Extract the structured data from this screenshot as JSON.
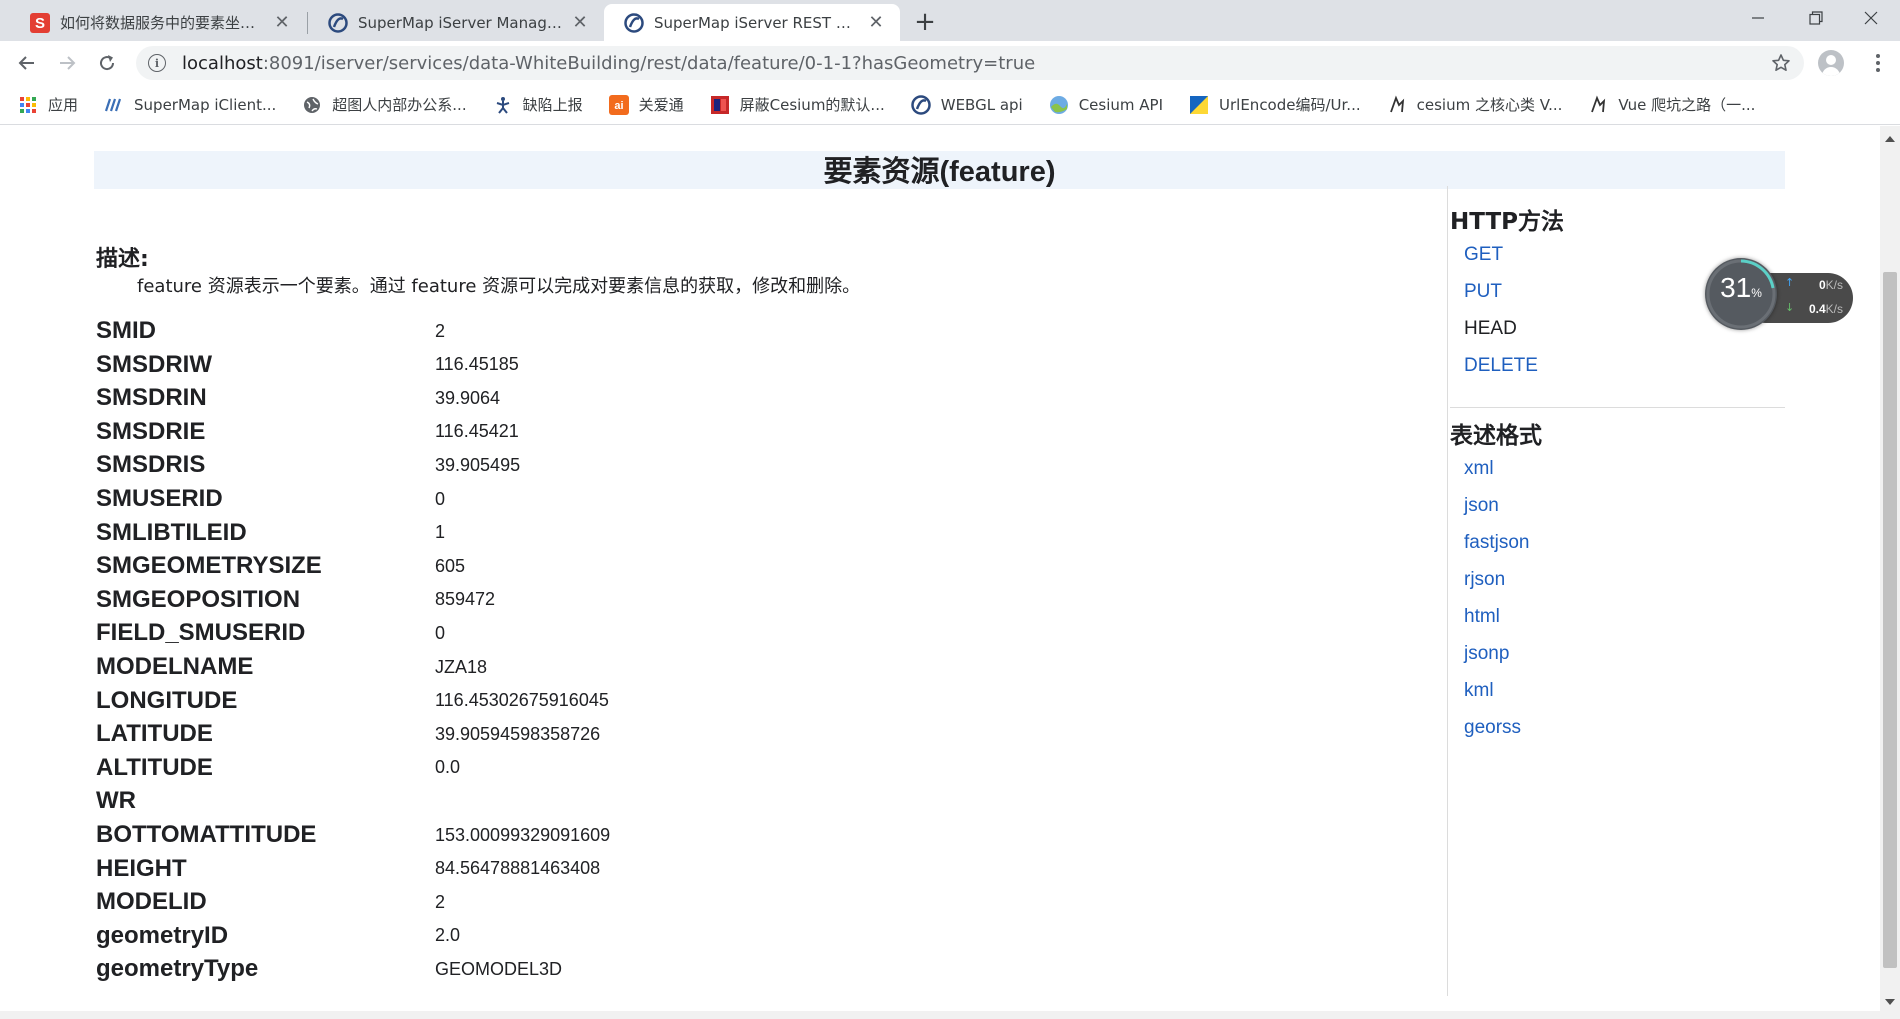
{
  "browser": {
    "tabs": [
      {
        "title": "如何将数据服务中的要素坐标转换",
        "favicon": "csdn-icon",
        "active": false
      },
      {
        "title": "SuperMap iServer Manager",
        "favicon": "supermap-icon",
        "active": false
      },
      {
        "title": "SuperMap iServer REST API",
        "favicon": "supermap-icon",
        "active": true
      }
    ],
    "url_host": "localhost",
    "url_rest": ":8091/iserver/services/data-WhiteBuilding/rest/data/feature/0-1-1?hasGeometry=true",
    "bookmarks": [
      {
        "label": "应用",
        "icon": "apps-grid-icon"
      },
      {
        "label": "SuperMap iClient...",
        "icon": "supermap-icon"
      },
      {
        "label": "超图人内部办公系...",
        "icon": "globe-icon"
      },
      {
        "label": "缺陷上报",
        "icon": "bug-icon"
      },
      {
        "label": "关爱通",
        "icon": "guanaitong-icon"
      },
      {
        "label": "屏蔽Cesium的默认...",
        "icon": "cesium-doc-icon"
      },
      {
        "label": "WEBGL api",
        "icon": "supermap-icon"
      },
      {
        "label": "Cesium API",
        "icon": "cesium-icon"
      },
      {
        "label": "UrlEncode编码/Ur...",
        "icon": "urlencode-icon"
      },
      {
        "label": "cesium 之核心类 V...",
        "icon": "juejin-icon"
      },
      {
        "label": "Vue 爬坑之路（一...",
        "icon": "juejin-icon"
      }
    ]
  },
  "page": {
    "title": "要素资源(feature)",
    "description_title": "描述:",
    "description_text": "feature 资源表示一个要素。通过 feature 资源可以完成对要素信息的获取，修改和删除。",
    "fields": [
      {
        "name": "SMID",
        "value": "2"
      },
      {
        "name": "SMSDRIW",
        "value": "116.45185"
      },
      {
        "name": "SMSDRIN",
        "value": "39.9064"
      },
      {
        "name": "SMSDRIE",
        "value": "116.45421"
      },
      {
        "name": "SMSDRIS",
        "value": "39.905495"
      },
      {
        "name": "SMUSERID",
        "value": "0"
      },
      {
        "name": "SMLIBTILEID",
        "value": "1"
      },
      {
        "name": "SMGEOMETRYSIZE",
        "value": "605"
      },
      {
        "name": "SMGEOPOSITION",
        "value": "859472"
      },
      {
        "name": "FIELD_SMUSERID",
        "value": "0"
      },
      {
        "name": "MODELNAME",
        "value": "JZA18"
      },
      {
        "name": "LONGITUDE",
        "value": "116.45302675916045"
      },
      {
        "name": "LATITUDE",
        "value": "39.90594598358726"
      },
      {
        "name": "ALTITUDE",
        "value": "0.0"
      },
      {
        "name": "WR",
        "value": ""
      },
      {
        "name": "BOTTOMATTITUDE",
        "value": "153.00099329091609"
      },
      {
        "name": "HEIGHT",
        "value": "84.56478881463408"
      },
      {
        "name": "MODELID",
        "value": "2"
      },
      {
        "name": "geometryID",
        "value": "2.0"
      },
      {
        "name": "geometryType",
        "value": "GEOMODEL3D"
      }
    ],
    "http_methods_title": "HTTP方法",
    "http_methods": [
      {
        "label": "GET",
        "link": true
      },
      {
        "label": "PUT",
        "link": true
      },
      {
        "label": "HEAD",
        "link": false
      },
      {
        "label": "DELETE",
        "link": true
      }
    ],
    "formats_title": "表述格式",
    "formats": [
      "xml",
      "json",
      "fastjson",
      "rjson",
      "html",
      "jsonp",
      "kml",
      "georss"
    ]
  },
  "speed_widget": {
    "percent": "31",
    "percent_unit": "%",
    "upload": "0",
    "upload_unit": "K/s",
    "download": "0.4",
    "download_unit": "K/s"
  },
  "colors": {
    "link": "#1f5fbf",
    "banner_bg": "#eef4fb",
    "tabstrip_bg": "#dee1e6"
  }
}
